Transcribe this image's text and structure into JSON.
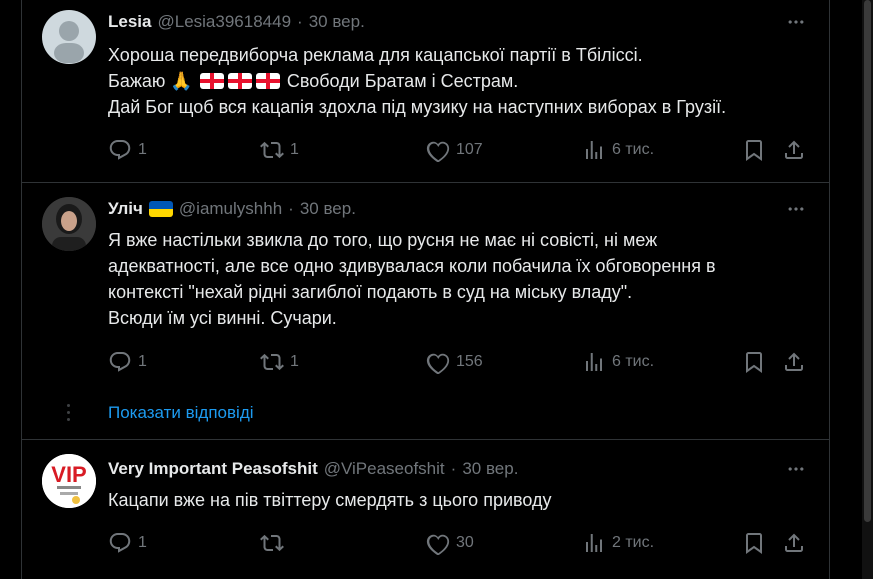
{
  "tweets": [
    {
      "name": "Lesia",
      "handle": "@Lesia39618449",
      "separator": "·",
      "time": "30 вер.",
      "lines": [
        "Хороша передвиборча реклама для кацапської партії в Тбіліссі.",
        "Свободи Братам і Сестрам.",
        "Дай Бог щоб вся кацапія здохла під музику на наступних виборах в Грузії."
      ],
      "line2_prefix": "Бажаю",
      "emoji_pray": "🙏",
      "stats": {
        "replies": "1",
        "reposts": "1",
        "likes": "107",
        "views": "6 тис."
      }
    },
    {
      "name": "Уліч",
      "handle": "@iamulyshhh",
      "separator": "·",
      "time": "30 вер.",
      "lines": [
        "Я вже настільки звикла до того, що русня не має ні совісті, ні меж",
        "адекватності, але все одно здивувалася коли побачила їх обговорення в",
        "контексті \"нехай рідні загиблої подають в суд на міську владу\".",
        "Всюди їм усі винні. Сучари."
      ],
      "stats": {
        "replies": "1",
        "reposts": "1",
        "likes": "156",
        "views": "6 тис."
      }
    },
    {
      "name": "Very Important Peasofshit",
      "handle": "@ViPeaseofshit",
      "separator": "·",
      "time": "30 вер.",
      "avatar_text": "VIP",
      "lines": [
        "Кацапи вже на пів твіттеру смердять з цього приводу"
      ],
      "stats": {
        "replies": "1",
        "reposts": "",
        "likes": "30",
        "views": "2 тис."
      }
    }
  ],
  "show_replies": "Показати відповіді",
  "colors": {
    "background": "#000000",
    "text": "#e7e9ea",
    "muted": "#71767b",
    "link": "#1d9bf0",
    "border": "#2f3336"
  }
}
